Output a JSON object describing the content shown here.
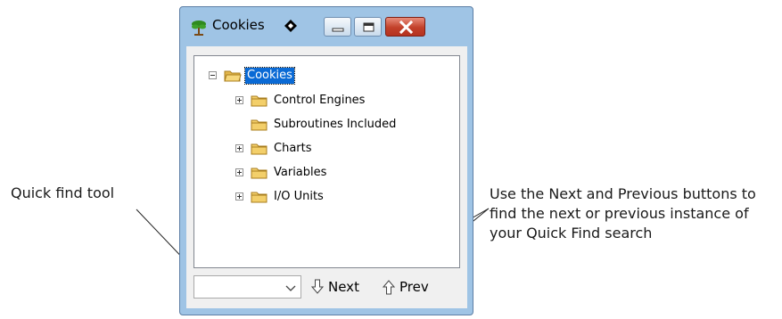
{
  "window": {
    "title": "Cookies",
    "icons": {
      "app": "tree-icon",
      "pin": "diamond-icon",
      "minimize": "minimize-icon",
      "maximize": "maximize-icon",
      "close": "close-icon"
    },
    "colors": {
      "frame": "#9fc4e5",
      "close": "#c2402a",
      "selection": "#0a6ad5"
    }
  },
  "tree": {
    "root": {
      "label": "Cookies",
      "expanded": true,
      "selected": true
    },
    "items": [
      {
        "label": "Control Engines",
        "has_children": true
      },
      {
        "label": "Subroutines Included",
        "has_children": false
      },
      {
        "label": "Charts",
        "has_children": true
      },
      {
        "label": "Variables",
        "has_children": true
      },
      {
        "label": "I/O Units",
        "has_children": true
      }
    ]
  },
  "quick_find": {
    "value": "",
    "next_label": "Next",
    "prev_label": "Prev"
  },
  "callouts": {
    "left": "Quick find tool",
    "right_lines": [
      "Use the Next and Previous buttons to",
      "find the next or previous instance of",
      "your Quick Find search"
    ]
  }
}
